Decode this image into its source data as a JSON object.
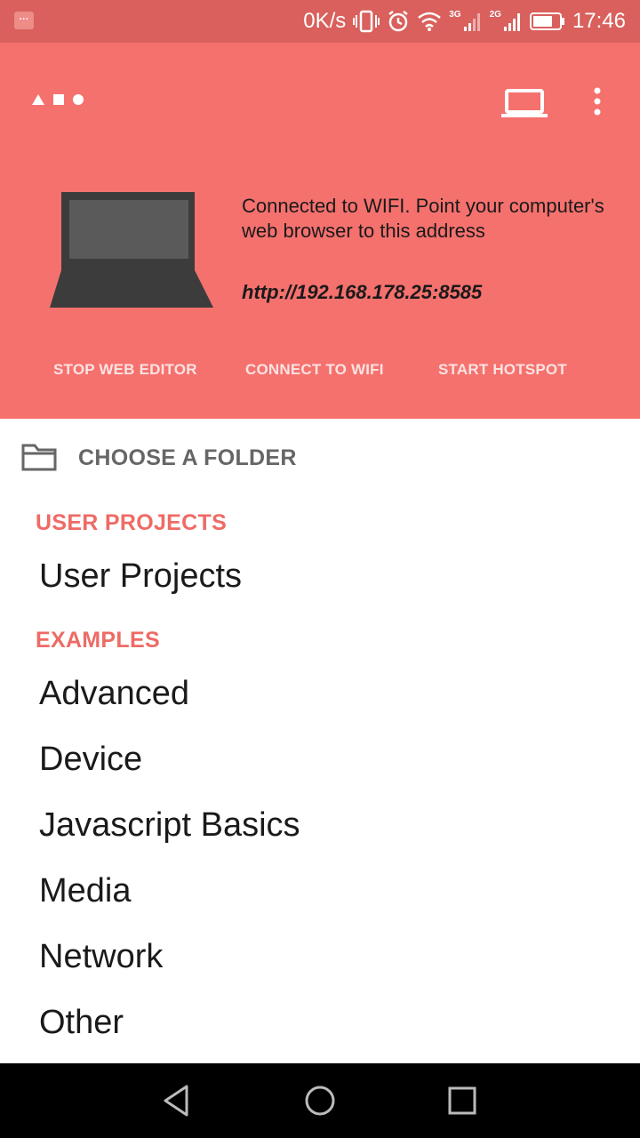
{
  "status_bar": {
    "net_speed": "0K/s",
    "net_3g": "3G",
    "net_2g": "2G",
    "time": "17:46",
    "battery_level": 0.75
  },
  "toolbar": {
    "logo_icon": "shapes-logo-icon",
    "laptop_icon": "laptop-icon",
    "more_icon": "more-vert-icon"
  },
  "web_editor": {
    "message": "Connected to WIFI. Point your computer's web browser to this address",
    "address": "http://192.168.178.25:8585",
    "actions": [
      "STOP WEB EDITOR",
      "CONNECT TO WIFI",
      "START HOTSPOT"
    ]
  },
  "folder_chooser": {
    "label": "CHOOSE A FOLDER",
    "icon": "folder-icon"
  },
  "sections": {
    "user_projects": {
      "title": "USER PROJECTS",
      "items": [
        "User Projects"
      ]
    },
    "examples": {
      "title": "EXAMPLES",
      "items": [
        "Advanced",
        "Device",
        "Javascript Basics",
        "Media",
        "Network",
        "Other"
      ]
    }
  },
  "colors": {
    "header_bg": "#F5716E",
    "status_bg": "#D9605C",
    "section_accent": "#EE6B66"
  }
}
